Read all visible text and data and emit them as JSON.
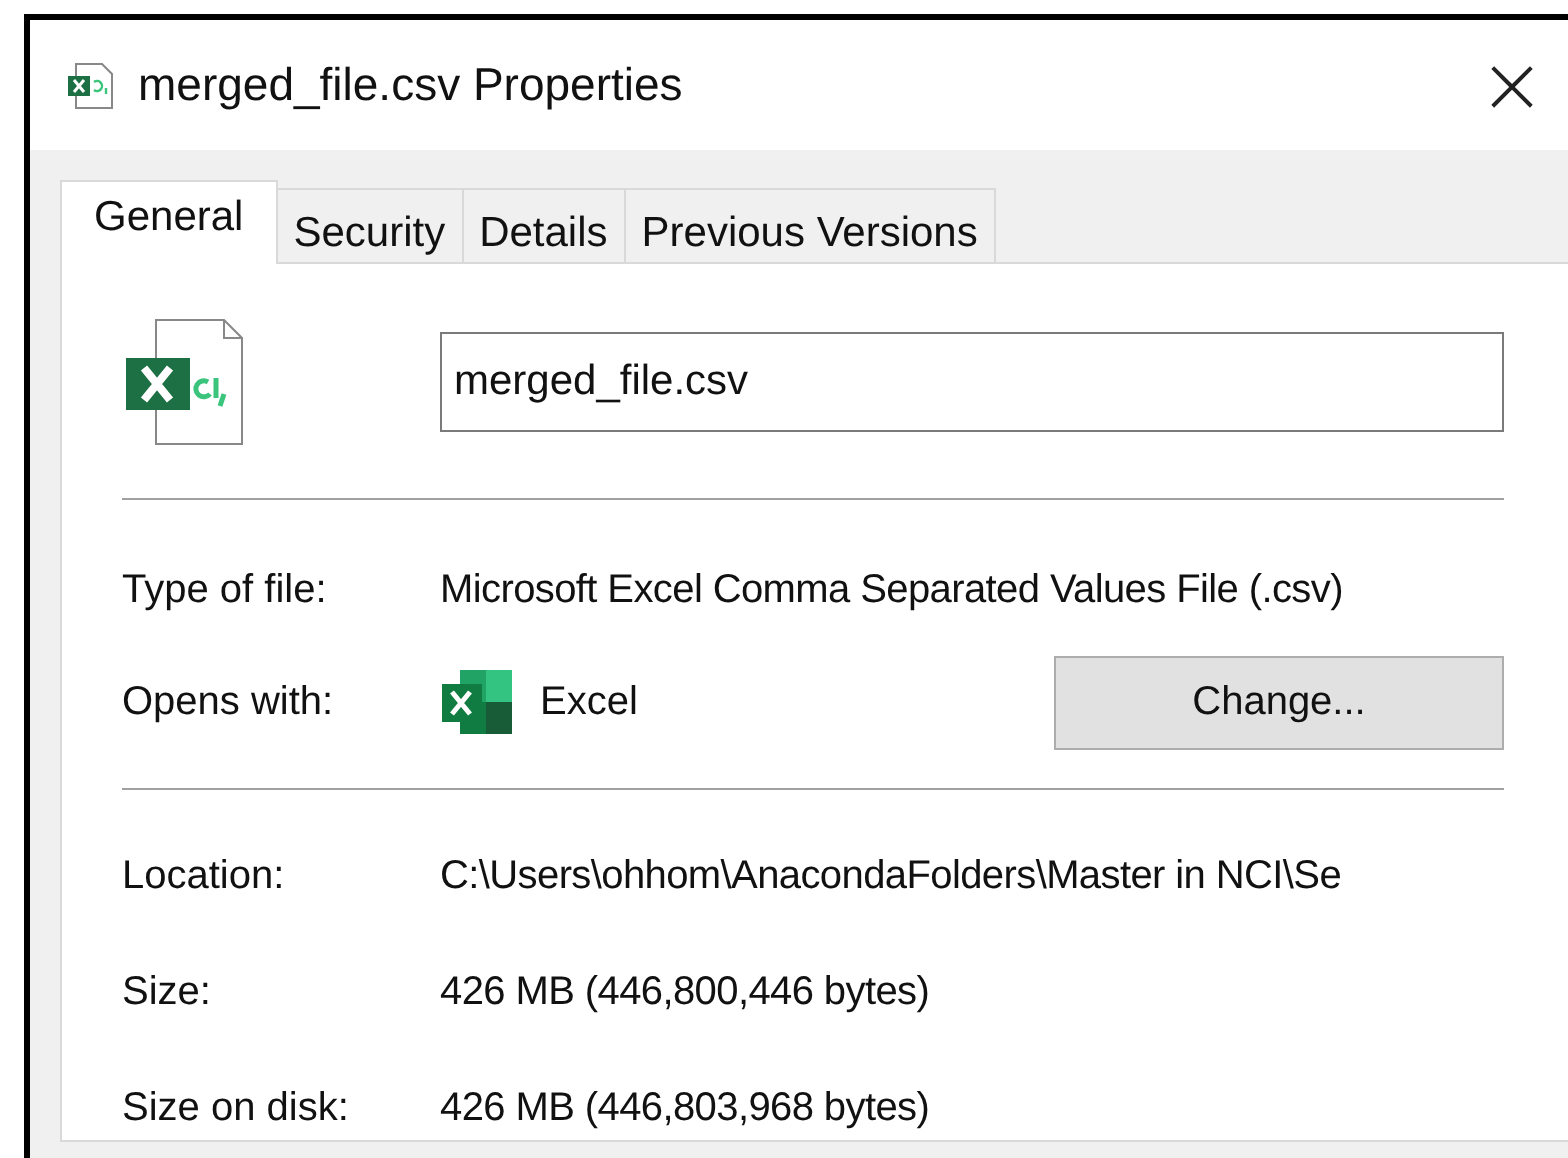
{
  "window": {
    "title": "merged_file.csv Properties",
    "close": "×"
  },
  "tabs": [
    {
      "label": "General",
      "selected": true
    },
    {
      "label": "Security",
      "selected": false
    },
    {
      "label": "Details",
      "selected": false
    },
    {
      "label": "Previous Versions",
      "selected": false
    }
  ],
  "file_name": {
    "value": "merged_file.csv"
  },
  "type_of_file": {
    "label": "Type of file:",
    "value": "Microsoft Excel Comma Separated Values File (.csv)"
  },
  "opens_with": {
    "label": "Opens with:",
    "app": "Excel",
    "button": "Change..."
  },
  "details": [
    {
      "label": "Location:",
      "value": "C:\\Users\\ohhom\\AnacondaFolders\\Master in NCI\\Se"
    },
    {
      "label": "Size:",
      "value": "426 MB (446,800,446 bytes)"
    },
    {
      "label": "Size on disk:",
      "value": "426 MB (446,803,968 bytes)"
    }
  ]
}
